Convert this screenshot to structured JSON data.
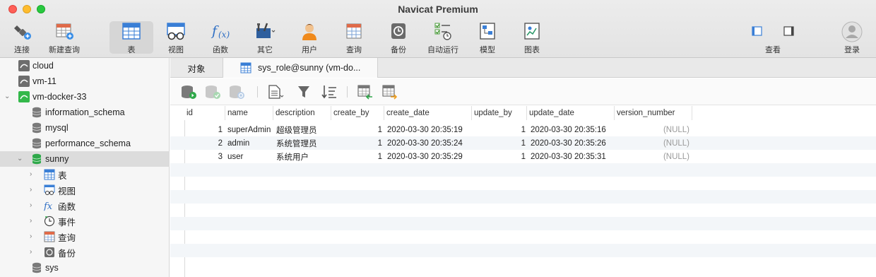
{
  "window": {
    "title": "Navicat Premium"
  },
  "toolbar": {
    "items": [
      {
        "label": "连接",
        "icon": "plug-icon"
      },
      {
        "label": "新建查询",
        "icon": "new-query-icon"
      },
      {
        "label": "表",
        "icon": "table-icon"
      },
      {
        "label": "视图",
        "icon": "view-icon"
      },
      {
        "label": "函数",
        "icon": "function-icon"
      },
      {
        "label": "其它",
        "icon": "tools-icon"
      },
      {
        "label": "用户",
        "icon": "user-icon"
      },
      {
        "label": "查询",
        "icon": "query-icon"
      },
      {
        "label": "备份",
        "icon": "backup-icon"
      },
      {
        "label": "自动运行",
        "icon": "automation-icon"
      },
      {
        "label": "模型",
        "icon": "model-icon"
      },
      {
        "label": "图表",
        "icon": "chart-icon"
      }
    ],
    "right": [
      {
        "label": "查看",
        "icon": "view-mode-icon"
      },
      {
        "label": "登录",
        "icon": "login-avatar-icon"
      }
    ]
  },
  "sidebar": {
    "connections": [
      {
        "label": "cloud"
      },
      {
        "label": "vm-11"
      },
      {
        "label": "vm-docker-33"
      }
    ],
    "databases": [
      {
        "label": "information_schema"
      },
      {
        "label": "mysql"
      },
      {
        "label": "performance_schema"
      },
      {
        "label": "sunny"
      }
    ],
    "sunny_children": [
      {
        "label": "表"
      },
      {
        "label": "视图"
      },
      {
        "label": "函数"
      },
      {
        "label": "事件"
      },
      {
        "label": "查询"
      },
      {
        "label": "备份"
      }
    ],
    "last_db": {
      "label": "sys"
    }
  },
  "tabs": {
    "objects": "对象",
    "table": "sys_role@sunny (vm-do..."
  },
  "grid": {
    "columns": [
      "id",
      "name",
      "description",
      "create_by",
      "create_date",
      "update_by",
      "update_date",
      "version_number"
    ],
    "rows": [
      {
        "id": "1",
        "name": "superAdmin",
        "description": "超级管理员",
        "create_by": "1",
        "create_date": "2020-03-30 20:35:19",
        "update_by": "1",
        "update_date": "2020-03-30 20:35:16",
        "version_number": "(NULL)"
      },
      {
        "id": "2",
        "name": "admin",
        "description": "系统管理员",
        "create_by": "1",
        "create_date": "2020-03-30 20:35:24",
        "update_by": "1",
        "update_date": "2020-03-30 20:35:26",
        "version_number": "(NULL)"
      },
      {
        "id": "3",
        "name": "user",
        "description": "系统用户",
        "create_by": "1",
        "create_date": "2020-03-30 20:35:29",
        "update_by": "1",
        "update_date": "2020-03-30 20:35:31",
        "version_number": "(NULL)"
      }
    ]
  }
}
